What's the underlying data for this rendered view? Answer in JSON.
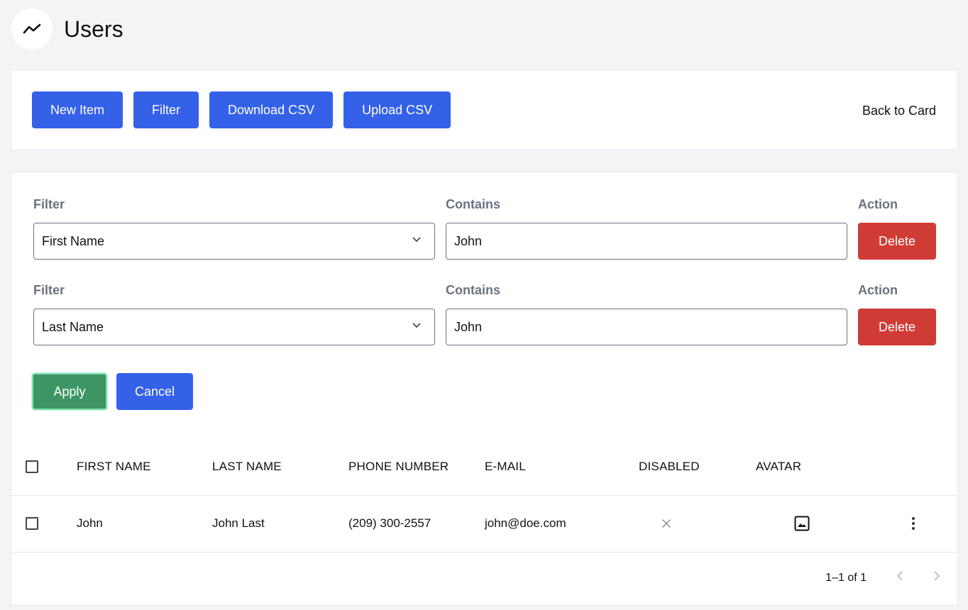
{
  "header": {
    "title": "Users",
    "logo_icon": "trend-line-icon"
  },
  "toolbar": {
    "buttons": [
      "New Item",
      "Filter",
      "Download CSV",
      "Upload CSV"
    ],
    "back_label": "Back to Card"
  },
  "filters": {
    "rows": [
      {
        "filter_label": "Filter",
        "contains_label": "Contains",
        "action_label": "Action",
        "field": "First Name",
        "value": "John",
        "delete_label": "Delete"
      },
      {
        "filter_label": "Filter",
        "contains_label": "Contains",
        "action_label": "Action",
        "field": "Last Name",
        "value": "John",
        "delete_label": "Delete"
      }
    ],
    "apply_label": "Apply",
    "cancel_label": "Cancel"
  },
  "table": {
    "columns": [
      "FIRST NAME",
      "LAST NAME",
      "PHONE NUMBER",
      "E-MAIL",
      "DISABLED",
      "AVATAR"
    ],
    "rows": [
      {
        "first_name": "John",
        "last_name": "John Last",
        "phone": "(209) 300-2557",
        "email": "john@doe.com",
        "disabled_icon": "close-x-icon",
        "avatar_icon": "image-icon"
      }
    ],
    "pagination": {
      "range": "1–1 of 1"
    }
  },
  "colors": {
    "primary": "#3461e8",
    "danger": "#d13b35",
    "success": "#3e9564"
  }
}
